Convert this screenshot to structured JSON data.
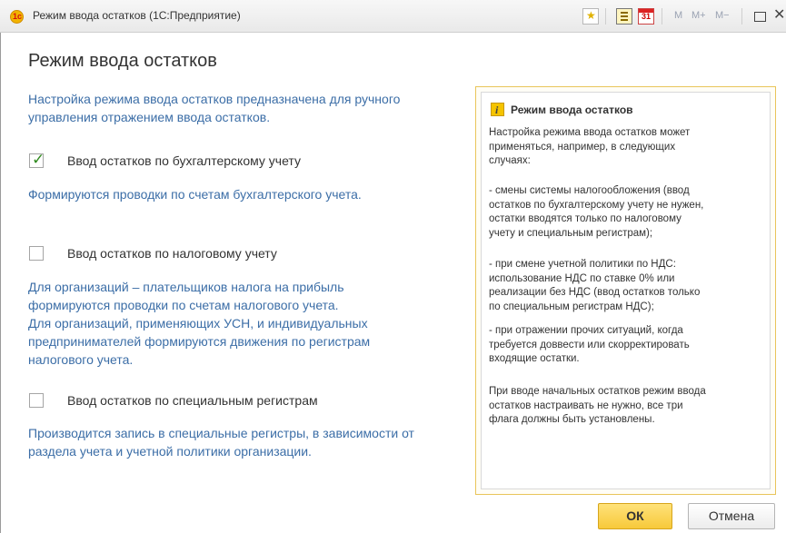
{
  "window": {
    "title": "Режим ввода остатков  (1С:Предприятие)",
    "logo_text": "1с",
    "calendar_text": "31",
    "memory_buttons": [
      "M",
      "M+",
      "M−"
    ],
    "close_glyph": "✕"
  },
  "form": {
    "heading": "Режим ввода остатков",
    "intro": [
      "Настройка режима ввода остатков предназначена для ручного",
      "управления отражением  ввода остатков."
    ],
    "options": [
      {
        "label": "Ввод остатков по бухгалтерскому учету",
        "checked": true,
        "description": [
          "Формируются проводки по счетам бухгалтерского учета."
        ]
      },
      {
        "label": "Ввод остатков по налоговому учету",
        "checked": false,
        "description": [
          "Для организаций – плательщиков налога на прибыль",
          "формируются проводки по счетам налогового учета.",
          "Для организаций, применяющих УСН, и  индивидуальных",
          "предпринимателей формируются движения по регистрам",
          "налогового учета."
        ]
      },
      {
        "label": "Ввод остатков по специальным регистрам",
        "checked": false,
        "description": [
          "Производится запись в специальные регистры, в зависимости от",
          "раздела учета и учетной политики организации."
        ]
      }
    ]
  },
  "info": {
    "icon_letter": "i",
    "heading": "Режим ввода остатков",
    "paragraphs": [
      [
        "Настройка режима ввода остатков может",
        "применяться, например, в следующих",
        "случаях:"
      ],
      [
        "- смены системы налогообложения (ввод",
        "остатков по бухгалтерскому учету не нужен,",
        "остатки вводятся только по налоговому",
        "учету и специальным регистрам);"
      ],
      [
        "- при смене учетной политики по НДС:",
        "использование НДС по ставке 0% или",
        "реализации без НДС (ввод остатков только",
        "по специальным регистрам НДС);"
      ],
      [
        "- при отражении прочих ситуаций, когда",
        "требуется доввести или скорректировать",
        "входящие остатки."
      ],
      [
        "При вводе начальных остатков режим ввода",
        "остатков настраивать не нужно, все три",
        "флага должны быть установлены."
      ]
    ]
  },
  "buttons": {
    "ok": "ОК",
    "cancel": "Отмена"
  }
}
